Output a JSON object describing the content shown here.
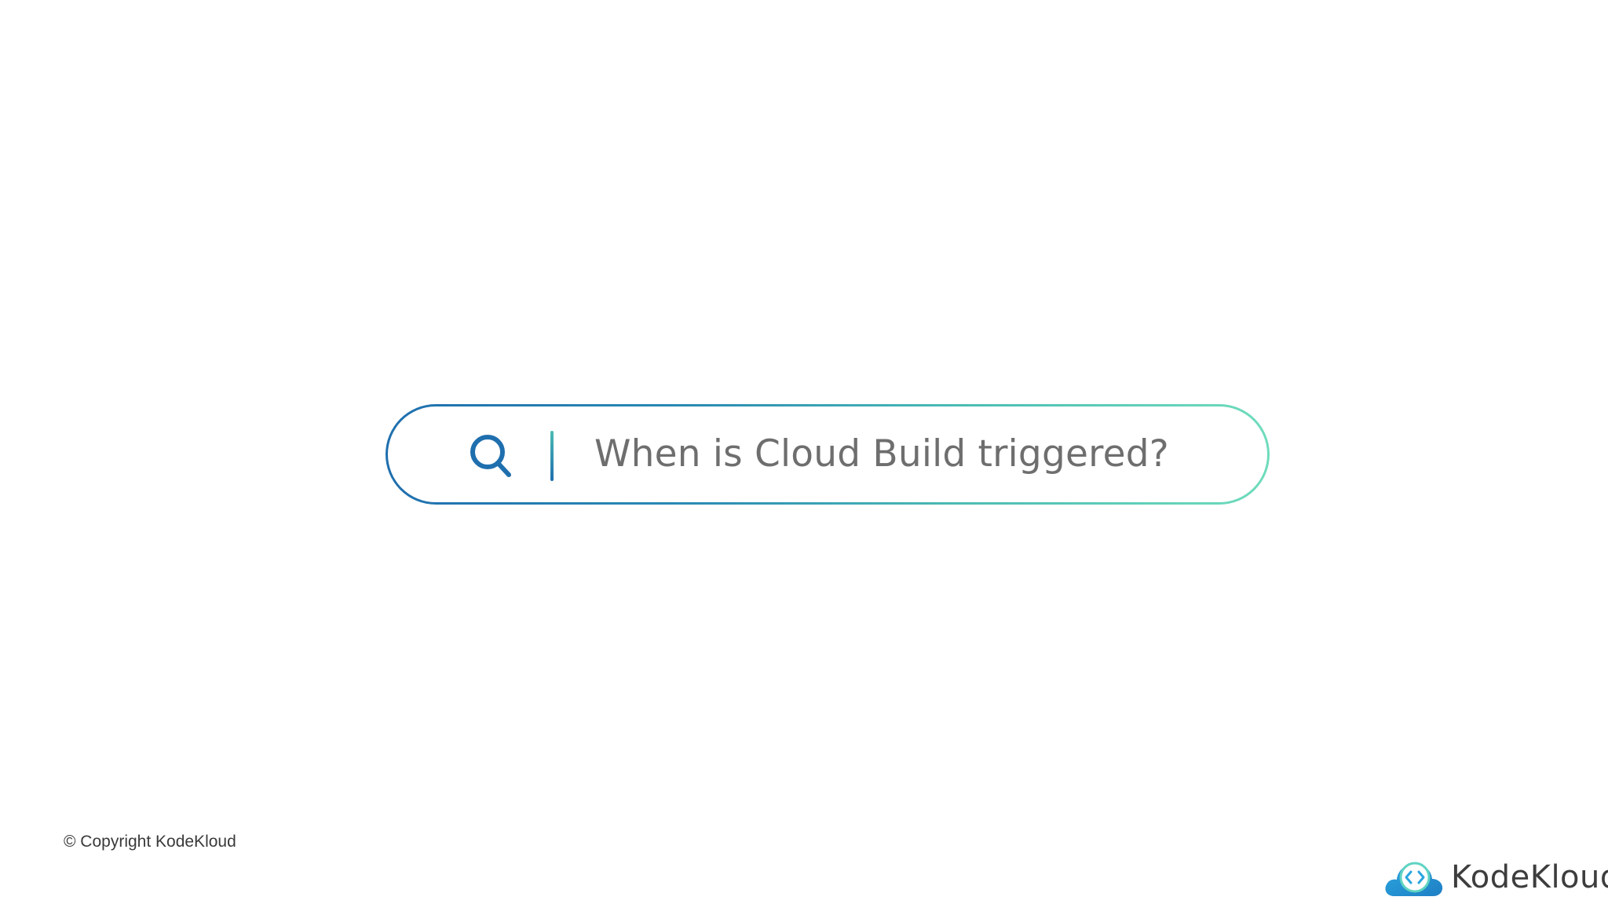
{
  "search": {
    "query": "When is Cloud Build triggered?",
    "icon": "search-icon"
  },
  "footer": {
    "copyright": "© Copyright KodeKloud"
  },
  "brand": {
    "name": "KodeKloud",
    "icon": "cloud-code-logo-icon"
  },
  "colors": {
    "gradient_start": "#1f6fae",
    "gradient_end": "#6fdcbc",
    "text": "#6e6e6e",
    "brand_blue": "#2aa6e0"
  }
}
